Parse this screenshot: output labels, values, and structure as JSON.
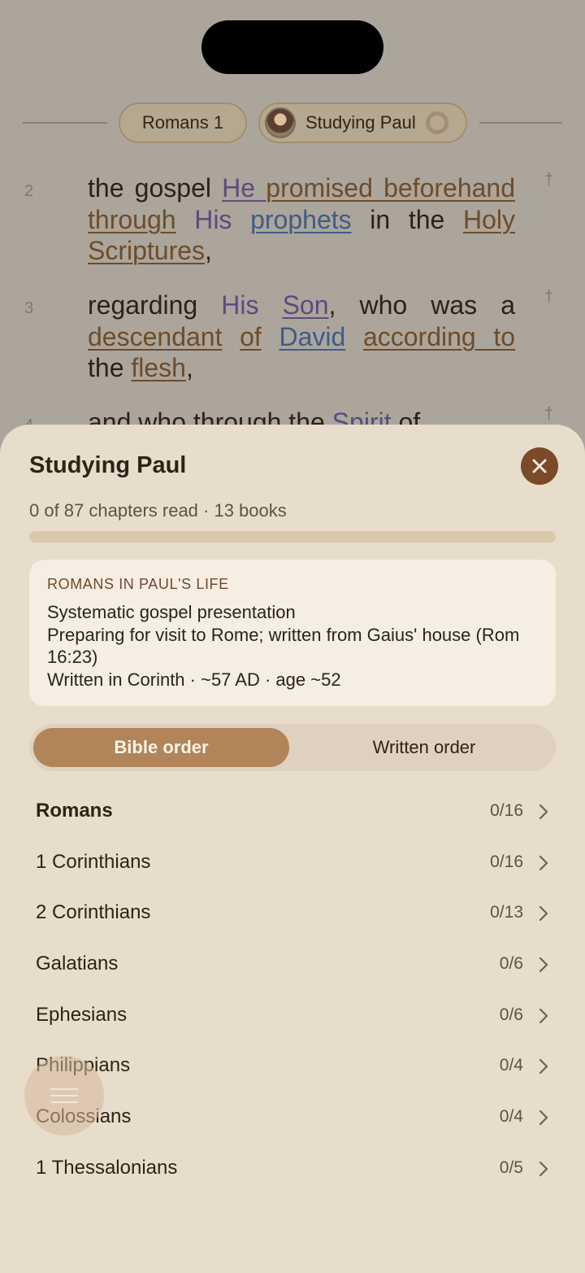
{
  "reader": {
    "book_chip": "Romans 1",
    "plan_chip": "Studying Paul",
    "verses": [
      {
        "num": "2",
        "cross": "†"
      },
      {
        "num": "3",
        "cross": "†"
      },
      {
        "num": "4",
        "cross": "†"
      }
    ]
  },
  "sheet": {
    "title": "Studying Paul",
    "progress_text": "0 of 87 chapters read · 13 books",
    "progress_fraction": 0,
    "info": {
      "heading": "ROMANS IN PAUL'S LIFE",
      "line1": "Systematic gospel presentation",
      "line2": "Preparing for visit to Rome; written from Gaius' house (Rom 16:23)",
      "line3": "Written in Corinth · ~57 AD · age ~52"
    },
    "order_options": {
      "bible": "Bible order",
      "written": "Written order"
    },
    "books": [
      {
        "name": "Romans",
        "count": "0/16"
      },
      {
        "name": "1 Corinthians",
        "count": "0/16"
      },
      {
        "name": "2 Corinthians",
        "count": "0/13"
      },
      {
        "name": "Galatians",
        "count": "0/6"
      },
      {
        "name": "Ephesians",
        "count": "0/6"
      },
      {
        "name": "Philippians",
        "count": "0/4"
      },
      {
        "name": "Colossians",
        "count": "0/4"
      },
      {
        "name": "1 Thessalonians",
        "count": "0/5"
      }
    ]
  },
  "colors": {
    "accent": "#b1845a",
    "close": "#7a4a2a",
    "sheet": "#e8dccb"
  }
}
